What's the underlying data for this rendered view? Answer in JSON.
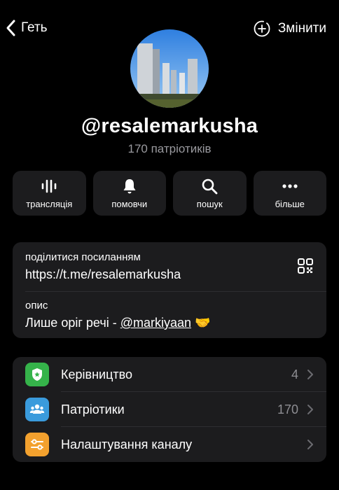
{
  "nav": {
    "back_label": "Геть",
    "edit_label": "Змінити"
  },
  "channel": {
    "name": "@resalemarkusha",
    "subscribers": "170 патріотиків"
  },
  "actions": [
    {
      "label": "трансляція",
      "icon": "broadcast-icon"
    },
    {
      "label": "помовчи",
      "icon": "bell-icon"
    },
    {
      "label": "пошук",
      "icon": "search-icon"
    },
    {
      "label": "більше",
      "icon": "more-icon"
    }
  ],
  "info": {
    "share_label": "поділитися посиланням",
    "share_link": "https://t.me/resalemarkusha",
    "description_label": "опис",
    "description_text": "Лише оріг речі - ",
    "description_mention": "@markiyaan",
    "description_emoji": "🤝"
  },
  "settings": [
    {
      "label": "Керівництво",
      "count": "4",
      "icon": "shield-star-icon",
      "color": "#35b34a"
    },
    {
      "label": "Патріотики",
      "count": "170",
      "icon": "people-icon",
      "color": "#3a9bdc"
    },
    {
      "label": "Налаштування каналу",
      "count": "",
      "icon": "sliders-icon",
      "color": "#f3a12e"
    }
  ],
  "colors": {
    "background": "#000000",
    "card": "#1c1c1e",
    "secondary_text": "#8e8e93"
  }
}
